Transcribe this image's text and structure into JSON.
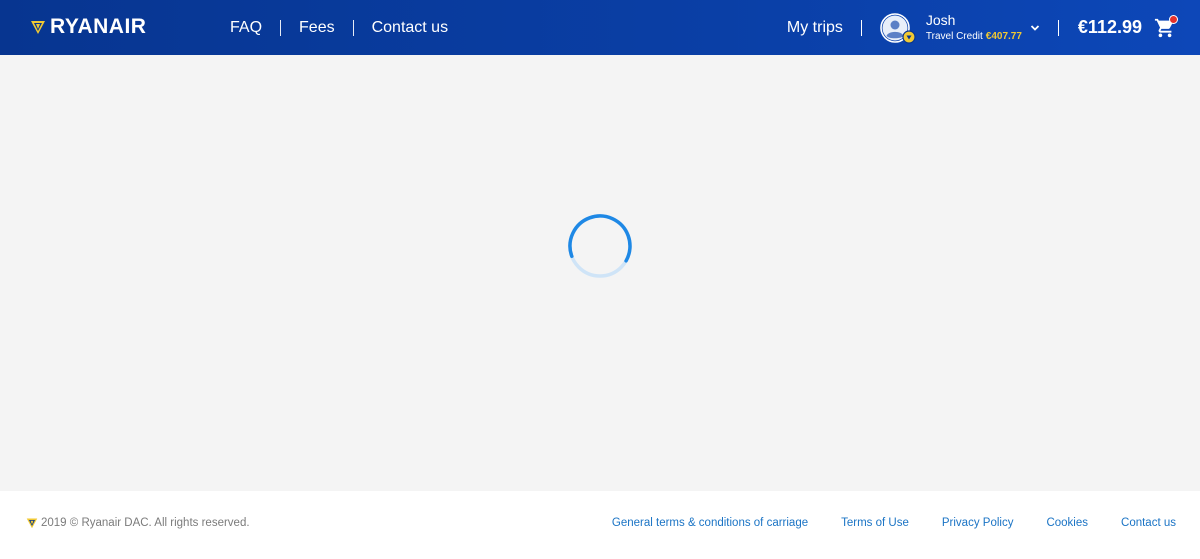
{
  "colors": {
    "header_bg": "#073590",
    "accent_gold": "#f1c933",
    "link_blue": "#1b74c5",
    "spinner_blue": "#1e88e5",
    "notification_red": "#e4312b",
    "page_bg": "#f4f4f4"
  },
  "header": {
    "logo_text": "RYANAIR",
    "logo_icon": "harp-icon",
    "nav": [
      {
        "label": "FAQ"
      },
      {
        "label": "Fees"
      },
      {
        "label": "Contact us"
      }
    ],
    "my_trips": "My trips",
    "user": {
      "name": "Josh",
      "credit_label": "Travel Credit",
      "credit_amount": "€407.77",
      "avatar_icon": "user-avatar-icon"
    },
    "basket_total": "€112.99",
    "cart_icon": "shopping-cart-icon"
  },
  "main": {
    "state": "loading",
    "spinner_icon": "loading-spinner-icon"
  },
  "footer": {
    "copyright": "2019 © Ryanair DAC. All rights reserved.",
    "links": [
      {
        "label": "General terms & conditions of carriage"
      },
      {
        "label": "Terms of Use"
      },
      {
        "label": "Privacy Policy"
      },
      {
        "label": "Cookies"
      },
      {
        "label": "Contact us"
      }
    ]
  }
}
